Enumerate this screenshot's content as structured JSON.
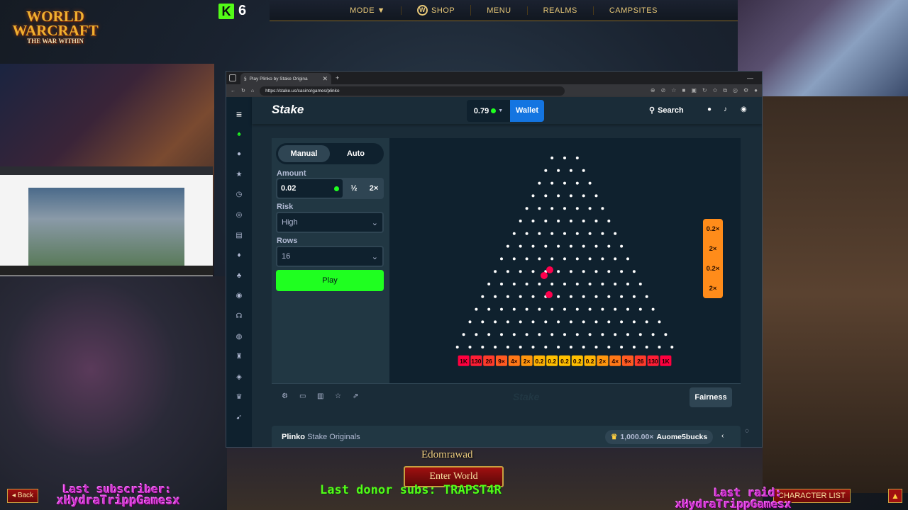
{
  "overlay": {
    "kick_count": "6",
    "logo_line1": "WORLD WARCRAFT",
    "logo_line2": "THE WAR WITHIN",
    "nav": [
      "MODE ▼",
      "SHOP",
      "MENU",
      "REALMS",
      "CAMPSITES"
    ],
    "character_name": "Edomrawad",
    "enter_world": "Enter World",
    "back": "Back",
    "character_list": "CHARACTER LIST",
    "last_subscriber_label": "Last subscriber:",
    "last_subscriber_name": "xHydraTrippGamesx",
    "last_donor": "Last donor subs: TRAPST4R",
    "last_raid_label": "Last raid:",
    "last_raid_name": "xHydraTrippGamesx"
  },
  "browser": {
    "tab_title": "Play Plinko by Stake Origina",
    "url": "https://stake.us/casino/games/plinko"
  },
  "stake": {
    "logo": "Stake",
    "balance": "0.79",
    "wallet": "Wallet",
    "search": "Search",
    "tabs": {
      "manual": "Manual",
      "auto": "Auto"
    },
    "amount_label": "Amount",
    "amount_value": "0.02",
    "half": "½",
    "double": "2×",
    "risk_label": "Risk",
    "risk_value": "High",
    "rows_label": "Rows",
    "rows_value": "16",
    "play": "Play",
    "fairness": "Fairness",
    "watermark": "Stake",
    "info_game": "Plinko",
    "info_sub": "Stake Originals",
    "info_amount": "1,000.00×",
    "info_user": "Auome5bucks"
  },
  "plinko": {
    "rows": 16,
    "multipliers": [
      "1K",
      "130",
      "26",
      "9×",
      "4×",
      "2×",
      "0.2",
      "0.2",
      "0.2",
      "0.2",
      "0.2",
      "2×",
      "4×",
      "9×",
      "26",
      "130",
      "1K"
    ],
    "slot_colors": [
      "#ff003f",
      "#ff1d35",
      "#ff3b2b",
      "#ff5a21",
      "#ff7817",
      "#ff960d",
      "#ffb503",
      "#ffc000",
      "#ffc000",
      "#ffc000",
      "#ffb503",
      "#ff960d",
      "#ff7817",
      "#ff5a21",
      "#ff3b2b",
      "#ff1d35",
      "#ff003f"
    ],
    "recent_results": [
      "0.2×",
      "2×",
      "0.2×",
      "2×"
    ],
    "recent_color": "#ff8c1a",
    "ball_color": "#ff004d"
  },
  "colors": {
    "accent_green": "#1fff20",
    "wallet_blue": "#1475e1",
    "panel": "#213743",
    "dark": "#0f212e"
  }
}
